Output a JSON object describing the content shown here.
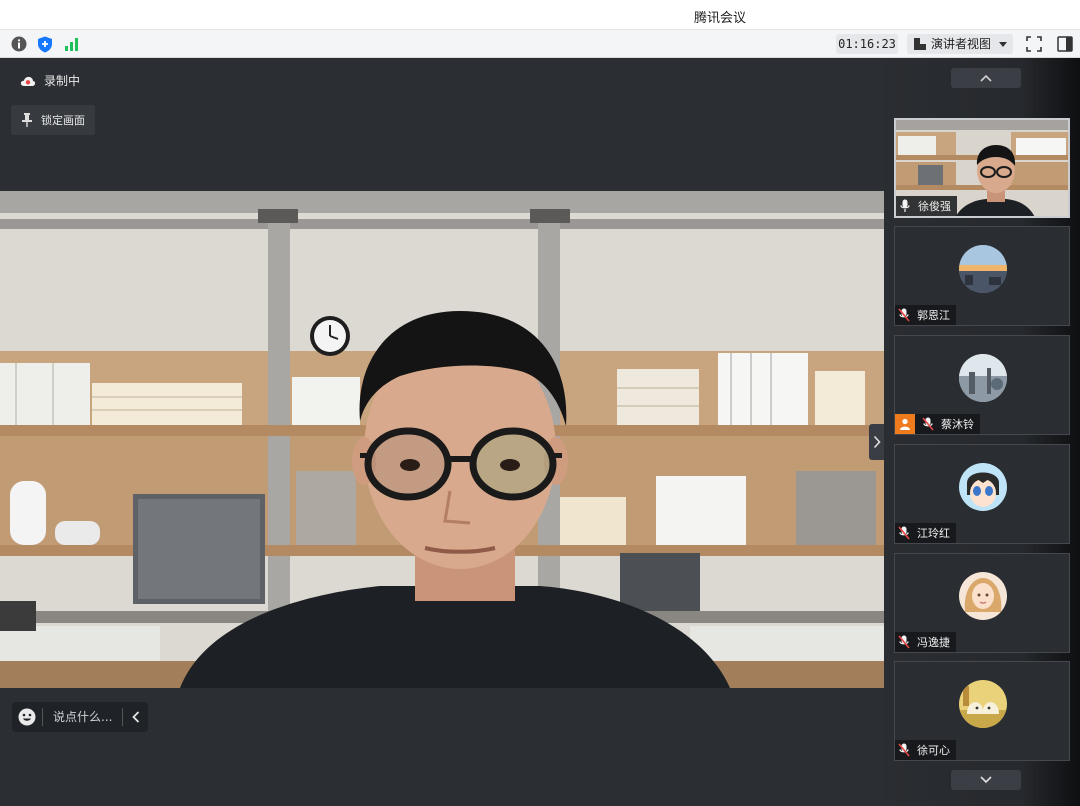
{
  "window": {
    "title": "腾讯会议"
  },
  "toolbar": {
    "info_icon": "info-icon",
    "shield_icon": "shield-icon",
    "signal_icon": "signal-icon",
    "timer": "01:16:23",
    "view_label": "演讲者视图",
    "fullscreen_icon": "fullscreen-icon",
    "sidebar_icon": "sidebar-toggle-icon"
  },
  "stage": {
    "recording_label": "录制中",
    "lock_label": "锁定画面",
    "chat_placeholder": "说点什么..."
  },
  "participants": [
    {
      "name": "徐俊强",
      "mic": "on",
      "video": true
    },
    {
      "name": "郭恩江",
      "mic": "muted",
      "video": false
    },
    {
      "name": "蔡沐铃",
      "mic": "muted",
      "video": false,
      "host": true
    },
    {
      "name": "江玲红",
      "mic": "muted",
      "video": false
    },
    {
      "name": "冯逸捷",
      "mic": "muted",
      "video": false
    },
    {
      "name": "徐可心",
      "mic": "muted",
      "video": false
    }
  ],
  "colors": {
    "accent": "#1677ff",
    "host_badge": "#f07b1d",
    "rec_red": "#e84545",
    "signal_green": "#1fbf5a"
  }
}
